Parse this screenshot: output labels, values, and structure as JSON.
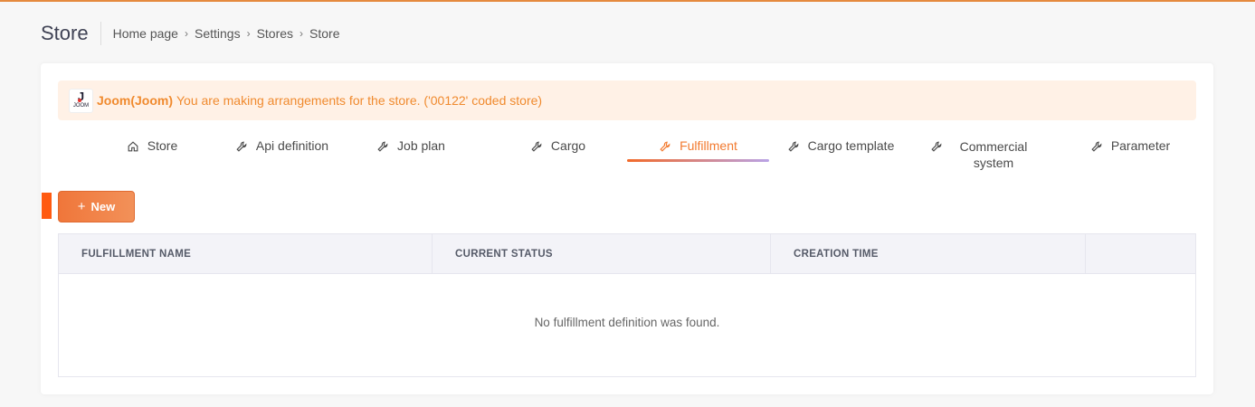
{
  "header": {
    "title": "Store",
    "breadcrumb": [
      "Home page",
      "Settings",
      "Stores",
      "Store"
    ]
  },
  "alert": {
    "logo_text": "JOOM",
    "store_name": "Joom(Joom)",
    "message": "You are making arrangements for the store. ('00122' coded store)"
  },
  "tabs": [
    {
      "label": "Store",
      "icon": "home-icon"
    },
    {
      "label": "Api definition",
      "icon": "wrench-icon"
    },
    {
      "label": "Job plan",
      "icon": "wrench-icon"
    },
    {
      "label": "Cargo",
      "icon": "wrench-icon"
    },
    {
      "label": "Fulfillment",
      "icon": "wrench-icon",
      "active": true
    },
    {
      "label": "Cargo template",
      "icon": "wrench-icon"
    },
    {
      "label": "Commercial system",
      "icon": "wrench-icon"
    },
    {
      "label": "Parameter",
      "icon": "wrench-icon"
    }
  ],
  "toolbar": {
    "new_label": "New",
    "new_icon": "+"
  },
  "table": {
    "columns": [
      "FULFILLMENT NAME",
      "CURRENT STATUS",
      "CREATION TIME",
      ""
    ],
    "empty_text": "No fulfillment definition was found."
  },
  "colors": {
    "accent": "#f27a2f",
    "alert_bg": "#fff1e6",
    "marker": "#ff5a10"
  }
}
